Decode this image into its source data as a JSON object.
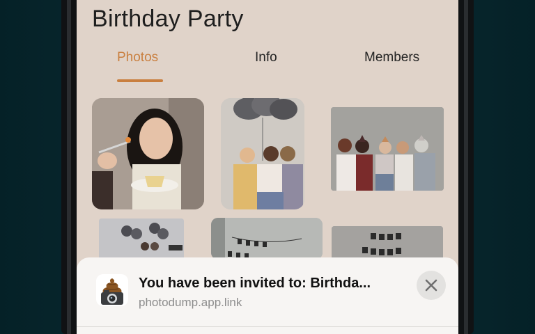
{
  "app": {
    "title": "Birthday Party"
  },
  "tabs": [
    {
      "label": "Photos",
      "active": true
    },
    {
      "label": "Info",
      "active": false
    },
    {
      "label": "Members",
      "active": false
    }
  ],
  "colors": {
    "accent": "#c97f3f",
    "background": "#e0d3c9",
    "sheet": "#f7f5f3"
  },
  "photos": [
    {
      "description": "woman eating cake"
    },
    {
      "description": "friends with balloons"
    },
    {
      "description": "group in party hats"
    },
    {
      "description": "friends with balloon wall"
    },
    {
      "description": "party banner"
    },
    {
      "description": "party banner"
    }
  ],
  "invite": {
    "icon": "poop-camera-icon",
    "title": "You have been invited to: Birthda...",
    "url": "photodump.app.link",
    "close_icon": "close-icon"
  }
}
